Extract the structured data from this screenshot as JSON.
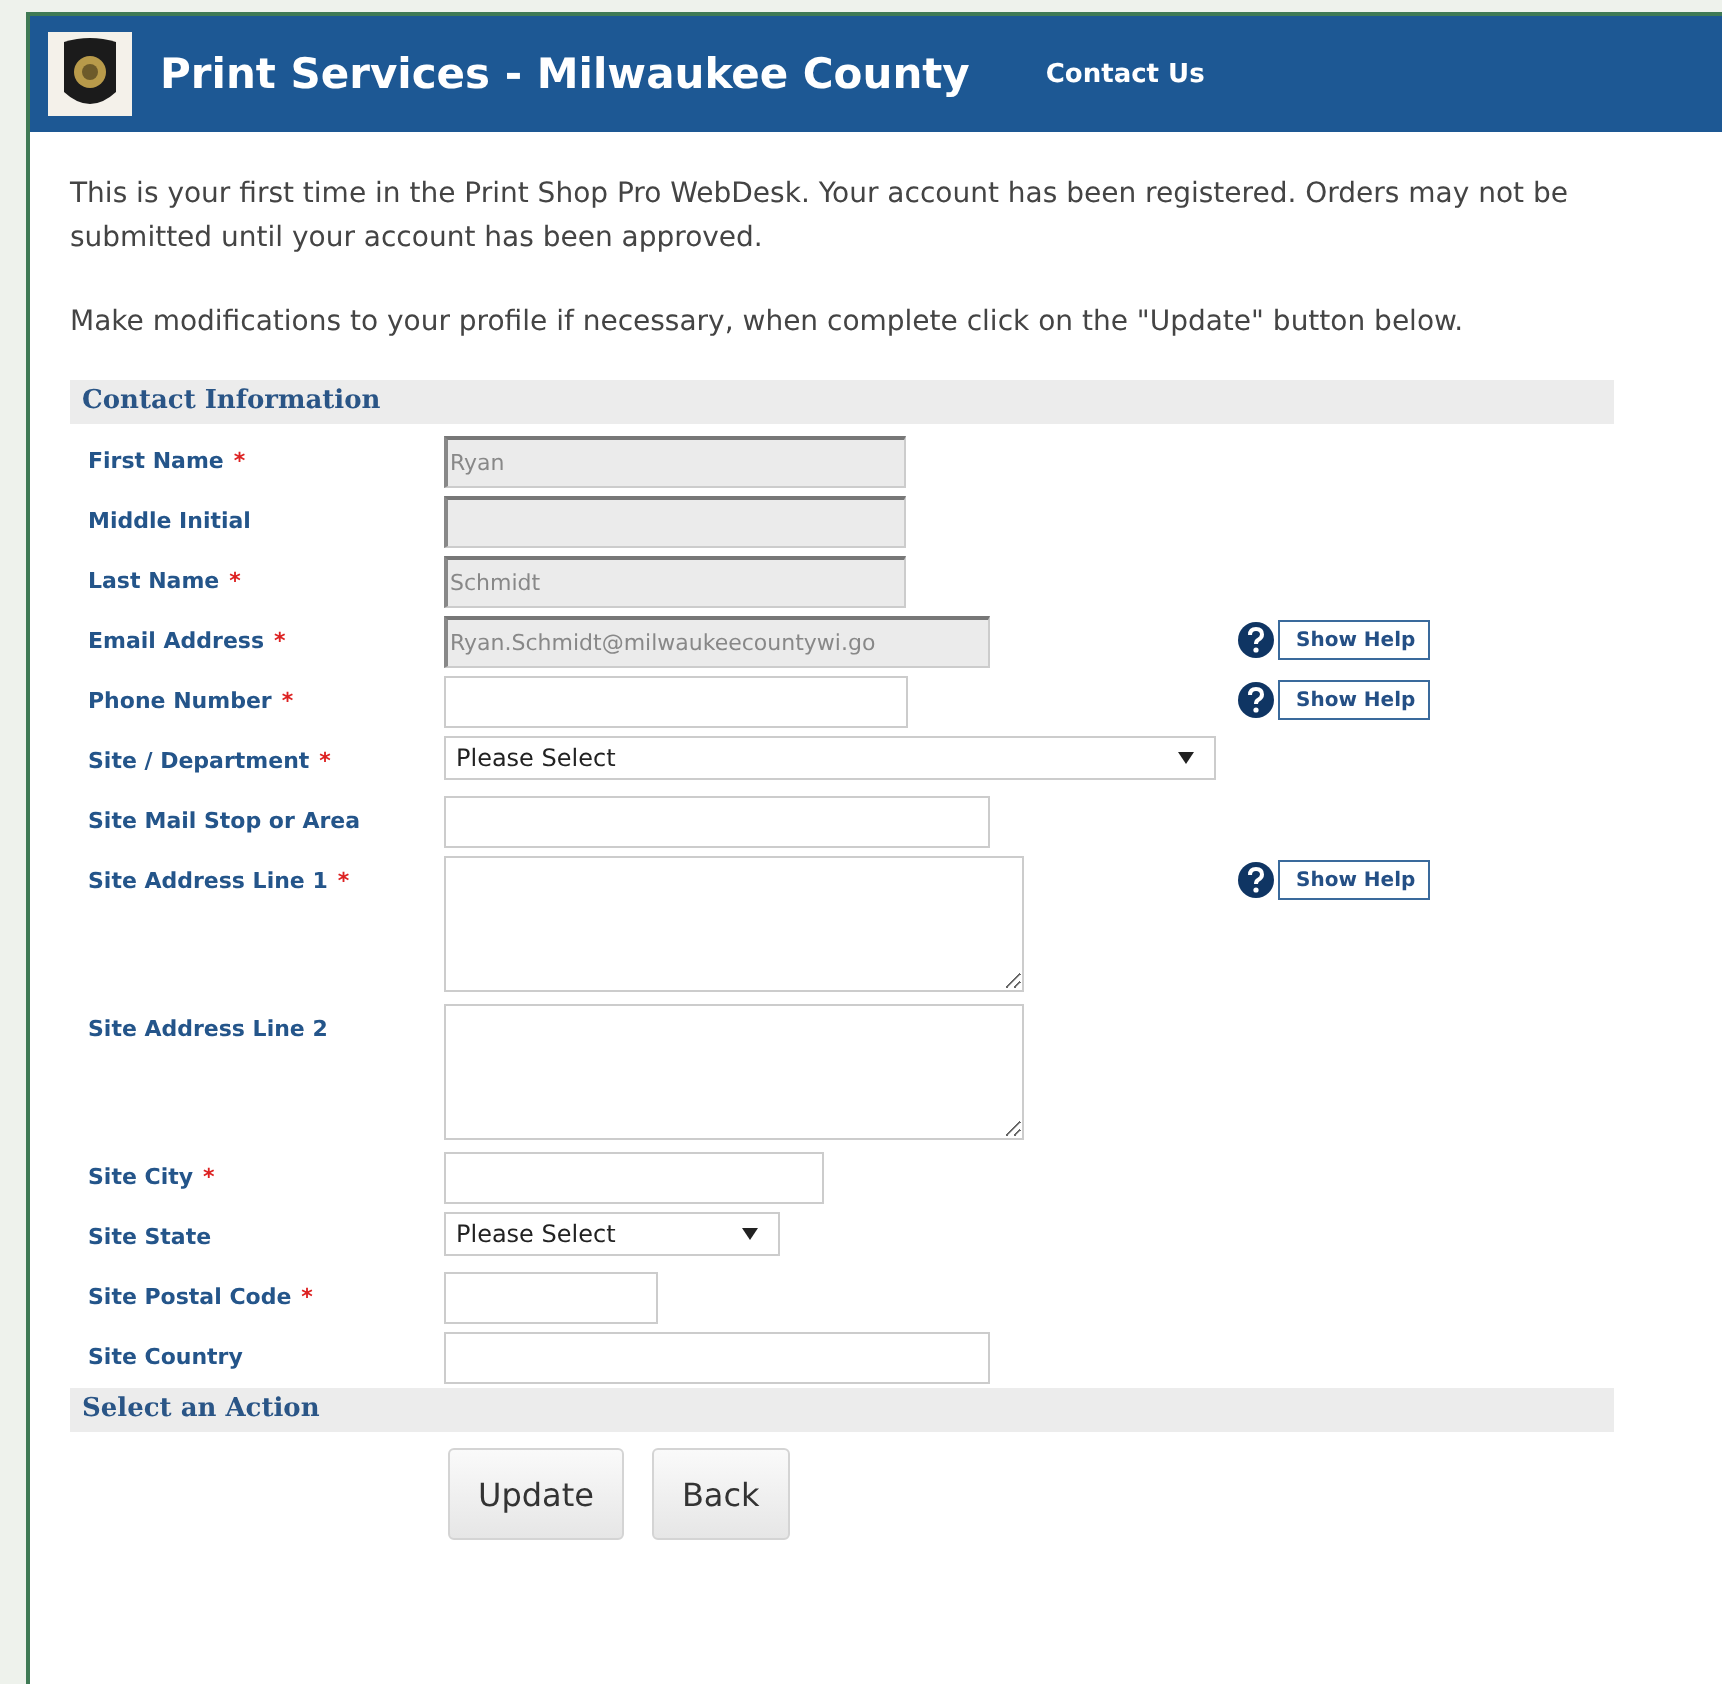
{
  "header": {
    "title": "Print Services - Milwaukee County",
    "link": "Contact Us"
  },
  "intro": [
    "This is your first time in the Print Shop Pro WebDesk. Your account has been registered. Orders may not be submitted until your account has been approved.",
    "Make modifications to your profile if necessary, when complete click on the \"Update\" button below."
  ],
  "contact_section": {
    "title": "Contact Information",
    "fields": [
      {
        "label": "First Name",
        "required_mark": "*",
        "kind": "text",
        "value": "Ryan",
        "disabled": true
      },
      {
        "label": "Middle Initial",
        "kind": "text",
        "disabled": true
      },
      {
        "label": "Last Name",
        "required_mark": "*",
        "kind": "text",
        "value": "Schmidt",
        "disabled": true
      },
      {
        "label": "Email Address",
        "required_mark": "*",
        "kind": "text",
        "value": "Ryan.Schmidt@milwaukeecountywi.go",
        "disabled": true,
        "help": "Show Help"
      },
      {
        "label": "Phone Number",
        "required_mark": "*",
        "kind": "text",
        "disabled": false,
        "help": "Show Help"
      },
      {
        "label": "Site / Department",
        "required_mark": "*",
        "kind": "select",
        "value": "Please Select",
        "disabled": false
      },
      {
        "label": "Site Mail Stop or Area",
        "kind": "text",
        "disabled": false
      },
      {
        "label": "Site Address Line 1",
        "required_mark": "*",
        "kind": "textarea",
        "disabled": false,
        "help": "Show Help"
      },
      {
        "label": "Site Address Line 2",
        "kind": "textarea",
        "disabled": false
      },
      {
        "label": "Site City",
        "required_mark": "*",
        "kind": "text",
        "disabled": false
      },
      {
        "label": "Site State",
        "kind": "select",
        "value": "Please Select",
        "disabled": false
      },
      {
        "label": "Site Postal Code",
        "required_mark": "*",
        "kind": "text",
        "disabled": false
      },
      {
        "label": "Site Country",
        "kind": "text",
        "disabled": false
      }
    ]
  },
  "action_section": {
    "title": "Select an Action",
    "buttons": [
      "Update",
      "Back"
    ]
  }
}
